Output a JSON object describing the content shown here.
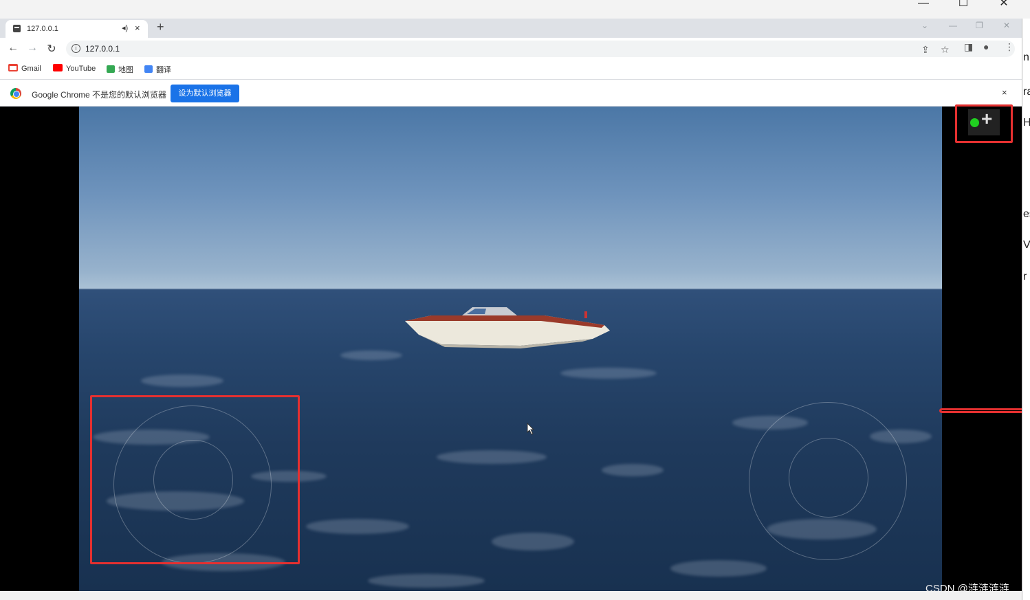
{
  "tab": {
    "title": "127.0.0.1",
    "audio_icon": "speaker-icon",
    "close": "×"
  },
  "new_tab": "+",
  "toolbar": {
    "url": "127.0.0.1"
  },
  "bookmarks": [
    {
      "label": "Gmail",
      "color": "#ea4335"
    },
    {
      "label": "YouTube",
      "color": "#ff0000"
    },
    {
      "label": "地图",
      "color": "#34a853"
    },
    {
      "label": "翻译",
      "color": "#4285f4"
    }
  ],
  "infobar": {
    "message": "Google Chrome 不是您的默认浏览器",
    "button": "设为默认浏览器",
    "close": "×"
  },
  "overlay": {
    "plus": "+",
    "status_color": "#20d020"
  },
  "right_edge_letters": [
    "n",
    "ra",
    "H",
    "es",
    "V",
    "r"
  ],
  "watermark": "CSDN @涟涟涟涟"
}
